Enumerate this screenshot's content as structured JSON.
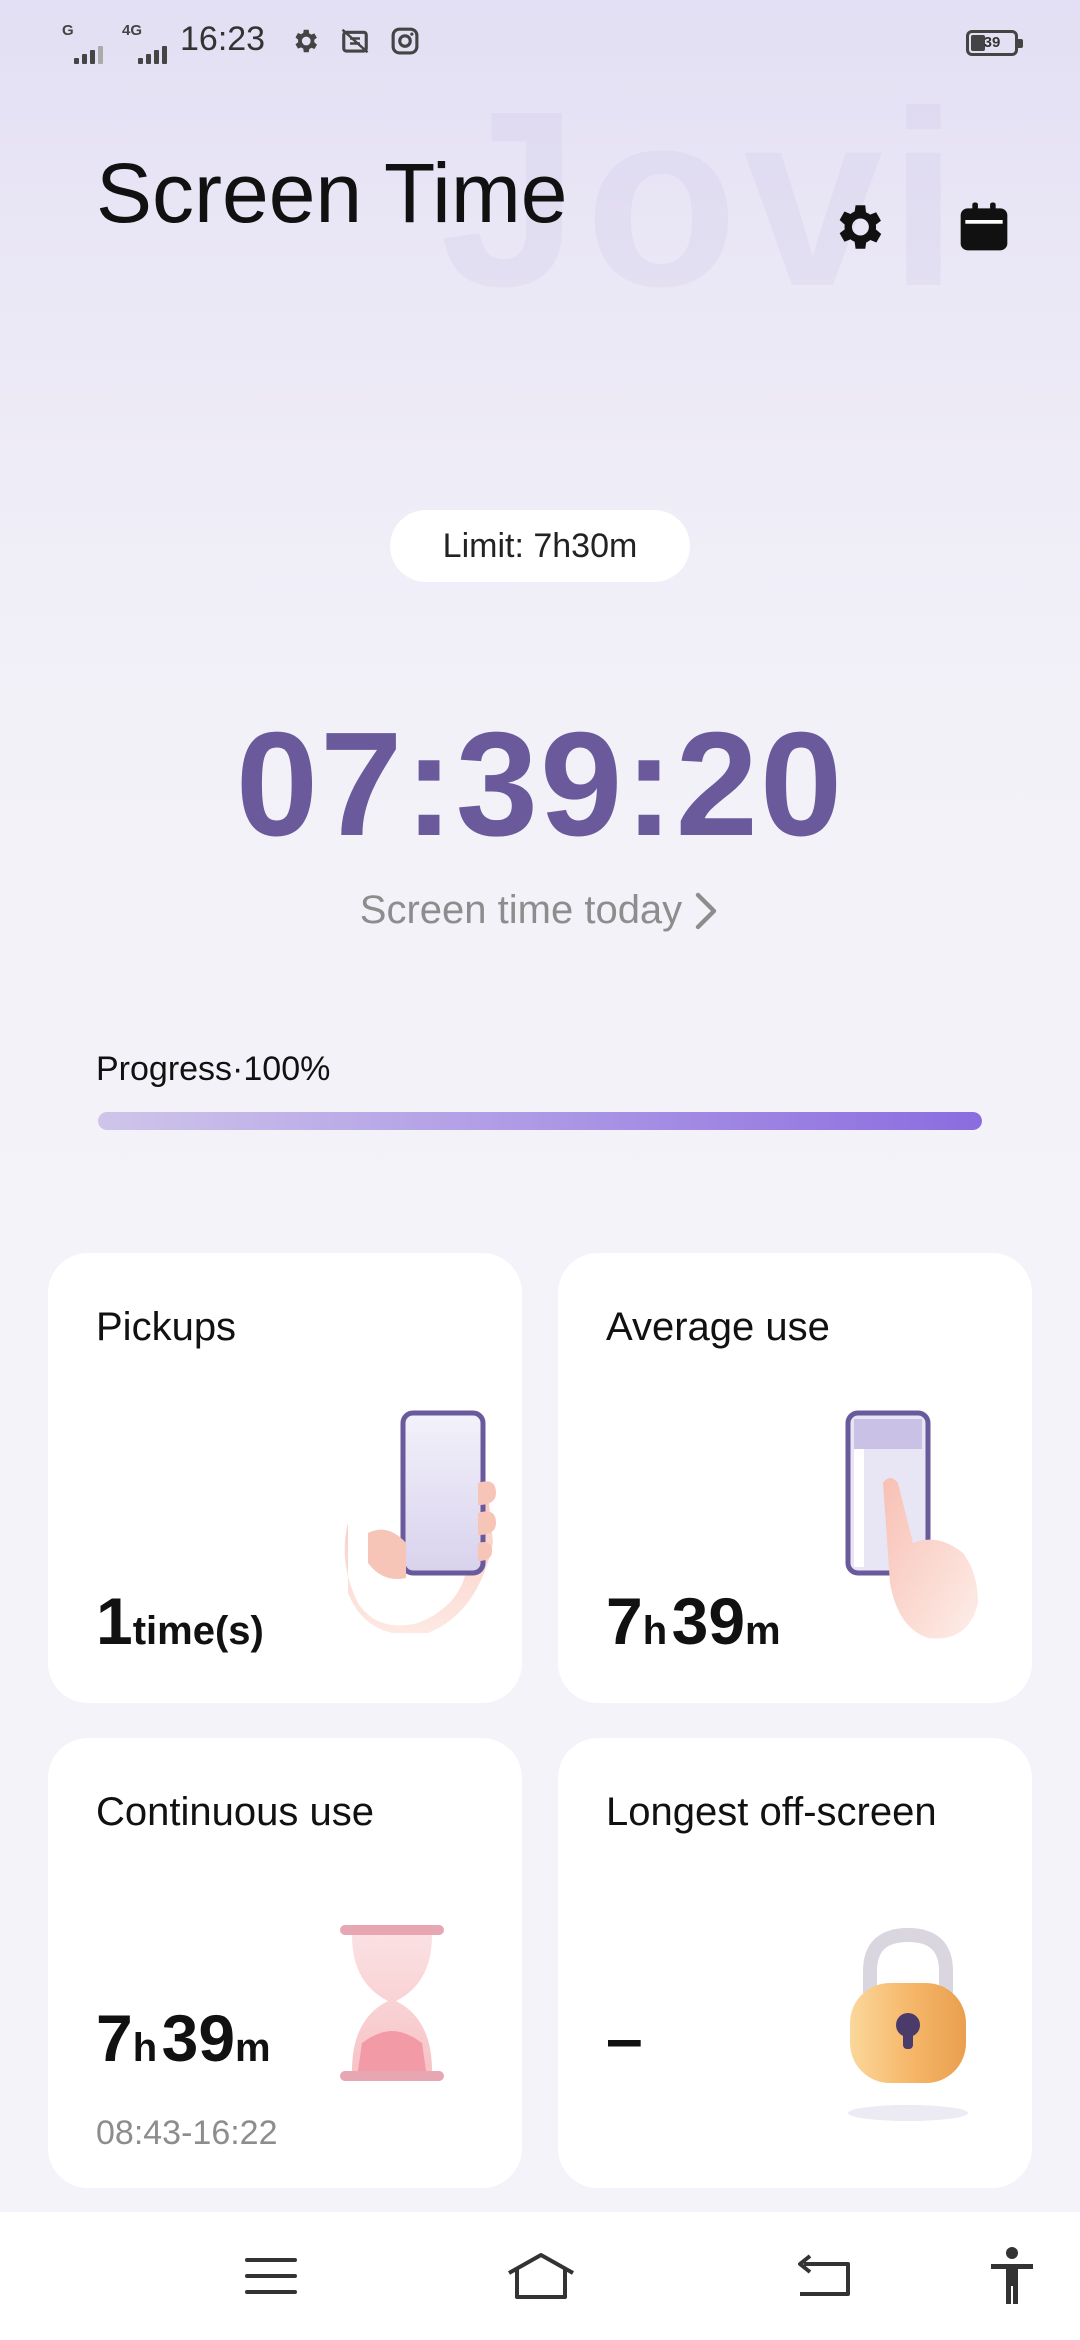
{
  "status_bar": {
    "signal_1_label": "G",
    "signal_2_label": "4G",
    "time": "16:23",
    "battery_level": "39",
    "icons": [
      "gear-icon",
      "screenshot-icon",
      "instagram-icon"
    ]
  },
  "header": {
    "watermark": "Jovi",
    "title": "Screen Time",
    "icons": [
      "settings-icon",
      "calendar-icon"
    ]
  },
  "limit": {
    "label": "Limit: 7h30m"
  },
  "timer": {
    "value": "07:39:20",
    "caption": "Screen time today"
  },
  "progress": {
    "label": "Progress·100%",
    "percent": 100
  },
  "cards": {
    "pickups": {
      "title": "Pickups",
      "count": "1",
      "unit": "time(s)"
    },
    "average_use": {
      "title": "Average use",
      "hours": "7",
      "hours_unit": "h",
      "minutes": "39",
      "minutes_unit": "m"
    },
    "continuous_use": {
      "title": "Continuous use",
      "hours": "7",
      "hours_unit": "h",
      "minutes": "39",
      "minutes_unit": "m",
      "range": "08:43-16:22"
    },
    "longest_off_screen": {
      "title": "Longest off-screen",
      "value": "–"
    }
  },
  "colors": {
    "accent": "#6a5a9c",
    "progress_end": "#8b6ce0",
    "card_bg": "#ffffff"
  },
  "nav": {
    "icons": [
      "menu-icon",
      "home-icon",
      "back-icon",
      "accessibility-icon"
    ]
  }
}
